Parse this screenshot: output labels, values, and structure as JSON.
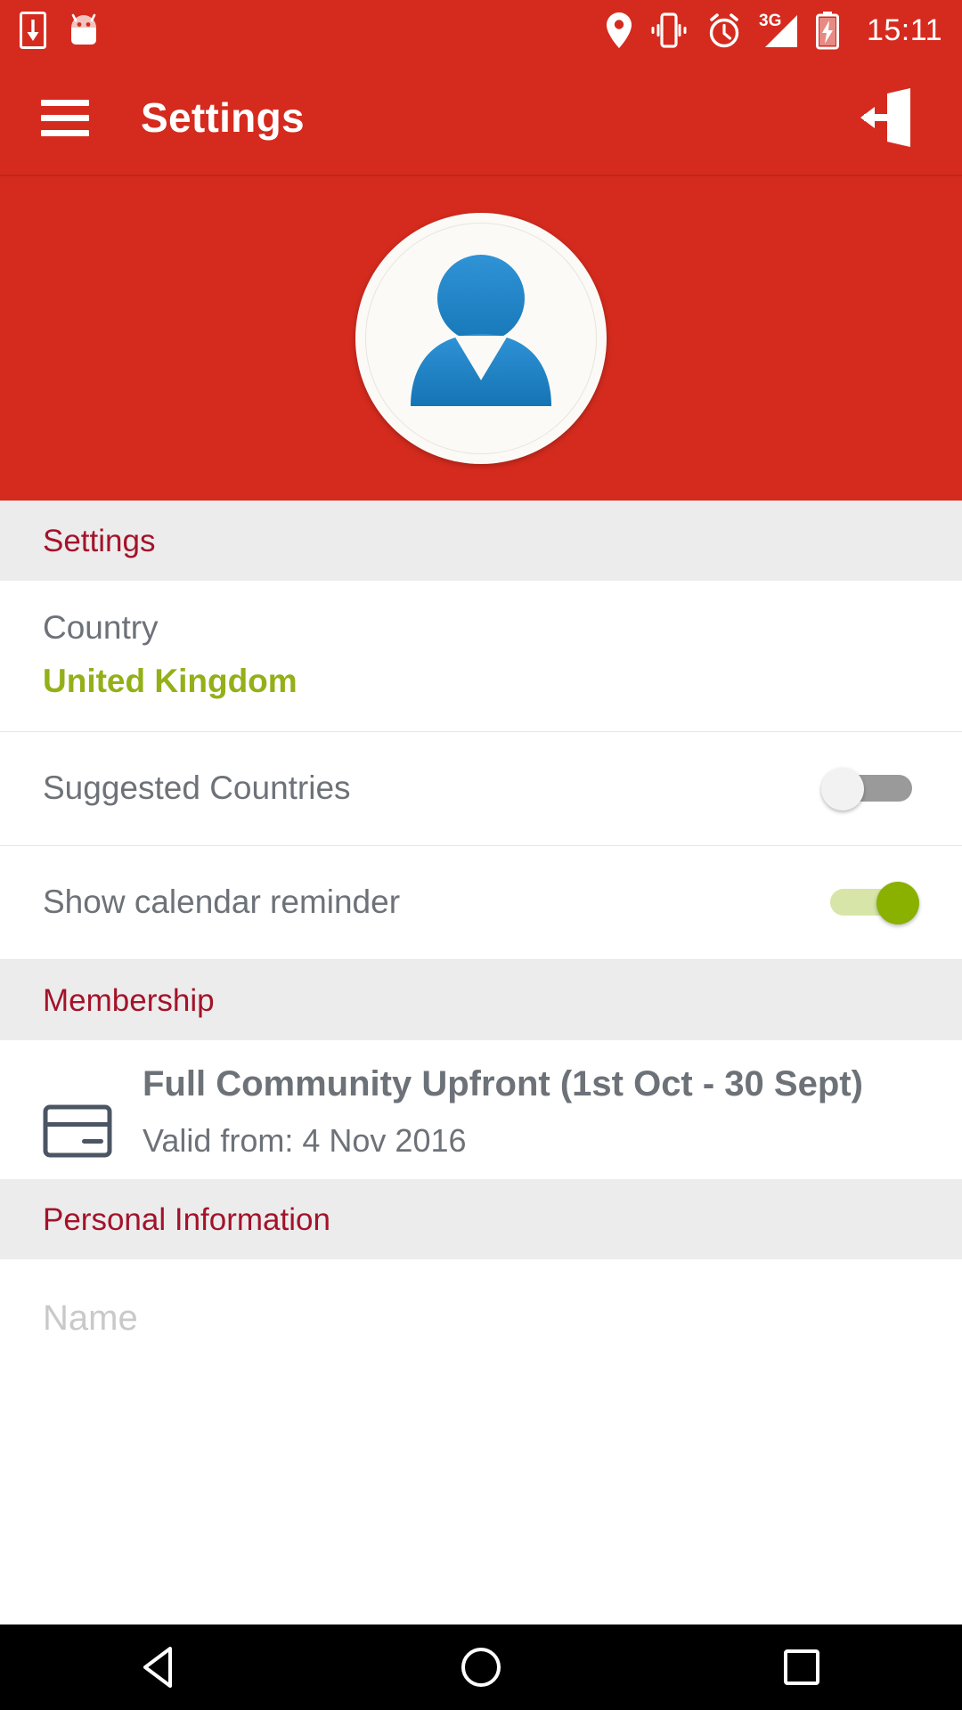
{
  "status_bar": {
    "icons_left": [
      "download-icon",
      "android-mascot-icon"
    ],
    "icons_right": [
      "location-icon",
      "vibrate-icon",
      "alarm-icon",
      "3g-signal-icon",
      "battery-charging-icon"
    ],
    "network_label": "3G",
    "time": "15:11"
  },
  "app_bar": {
    "menu_icon": "hamburger-menu-icon",
    "title": "Settings",
    "logout_icon": "logout-icon"
  },
  "hero": {
    "avatar_icon": "user-avatar-icon"
  },
  "sections": {
    "settings": {
      "header": "Settings",
      "country_label": "Country",
      "country_value": "United Kingdom",
      "suggested_countries_label": "Suggested Countries",
      "suggested_countries_state": "off",
      "calendar_reminder_label": "Show calendar reminder",
      "calendar_reminder_state": "on"
    },
    "membership": {
      "header": "Membership",
      "card_icon": "credit-card-icon",
      "plan_title": "Full Community Upfront (1st Oct - 30 Sept)",
      "valid_from": "Valid from: 4 Nov 2016"
    },
    "personal_information": {
      "header": "Personal Information",
      "name_placeholder": "Name"
    }
  },
  "nav_bar": {
    "back": "back-triangle-icon",
    "home": "home-circle-icon",
    "recents": "recents-square-icon"
  },
  "colors": {
    "brand_red": "#d52b1e",
    "section_header_text": "#a3132a",
    "section_header_bg": "#ececec",
    "accent_green": "#93b018",
    "toggle_on": "#8ab000",
    "body_text": "#6d7278"
  }
}
